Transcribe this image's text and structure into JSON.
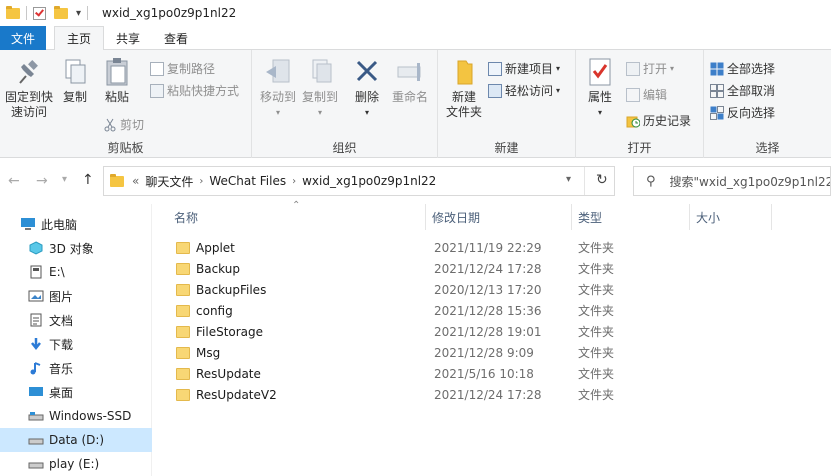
{
  "window": {
    "title": "wxid_xg1po0z9p1nl22"
  },
  "menu": {
    "file": "文件",
    "tabs": [
      "主页",
      "共享",
      "查看"
    ],
    "active_tab": "主页"
  },
  "ribbon": {
    "clipboard": {
      "label": "剪贴板",
      "pin": "固定到快\n速访问",
      "copy": "复制",
      "paste": "粘贴",
      "copy_path": "复制路径",
      "paste_shortcut": "粘贴快捷方式",
      "cut": "剪切"
    },
    "organize": {
      "label": "组织",
      "move_to": "移动到",
      "copy_to": "复制到",
      "delete": "删除",
      "rename": "重命名"
    },
    "new": {
      "label": "新建",
      "new_folder": "新建\n文件夹",
      "new_item": "新建项目",
      "easy_access": "轻松访问"
    },
    "open": {
      "label": "打开",
      "properties": "属性",
      "open": "打开",
      "edit": "编辑",
      "history": "历史记录"
    },
    "select": {
      "label": "选择",
      "select_all": "全部选择",
      "select_none": "全部取消",
      "invert": "反向选择"
    }
  },
  "address": {
    "prefix": "«",
    "crumbs": [
      "聊天文件",
      "WeChat Files",
      "wxid_xg1po0z9p1nl22"
    ]
  },
  "search": {
    "placeholder": "搜索\"wxid_xg1po0z9p1nl22\""
  },
  "nav": {
    "items": [
      {
        "label": "此电脑",
        "icon": "computer-icon"
      },
      {
        "label": "3D 对象",
        "icon": "3d-objects-icon"
      },
      {
        "label": "E:\\",
        "icon": "drive-icon"
      },
      {
        "label": "图片",
        "icon": "pictures-icon"
      },
      {
        "label": "文档",
        "icon": "documents-icon"
      },
      {
        "label": "下载",
        "icon": "download-icon"
      },
      {
        "label": "音乐",
        "icon": "music-icon"
      },
      {
        "label": "桌面",
        "icon": "desktop-icon"
      },
      {
        "label": "Windows-SSD",
        "icon": "drive-icon"
      },
      {
        "label": "Data (D:)",
        "icon": "drive-icon"
      },
      {
        "label": "play (E:)",
        "icon": "drive-icon"
      }
    ],
    "selected": "Data (D:)"
  },
  "list": {
    "columns": [
      "名称",
      "修改日期",
      "类型",
      "大小"
    ],
    "rows": [
      {
        "name": "Applet",
        "date": "2021/11/19 22:29",
        "type": "文件夹"
      },
      {
        "name": "Backup",
        "date": "2021/12/24 17:28",
        "type": "文件夹"
      },
      {
        "name": "BackupFiles",
        "date": "2020/12/13 17:20",
        "type": "文件夹"
      },
      {
        "name": "config",
        "date": "2021/12/28 15:36",
        "type": "文件夹"
      },
      {
        "name": "FileStorage",
        "date": "2021/12/28 19:01",
        "type": "文件夹"
      },
      {
        "name": "Msg",
        "date": "2021/12/28 9:09",
        "type": "文件夹"
      },
      {
        "name": "ResUpdate",
        "date": "2021/5/16 10:18",
        "type": "文件夹"
      },
      {
        "name": "ResUpdateV2",
        "date": "2021/12/24 17:28",
        "type": "文件夹"
      }
    ]
  },
  "colors": {
    "accent": "#1979ca",
    "selected": "#cce8ff",
    "folder": "#f8d775"
  }
}
